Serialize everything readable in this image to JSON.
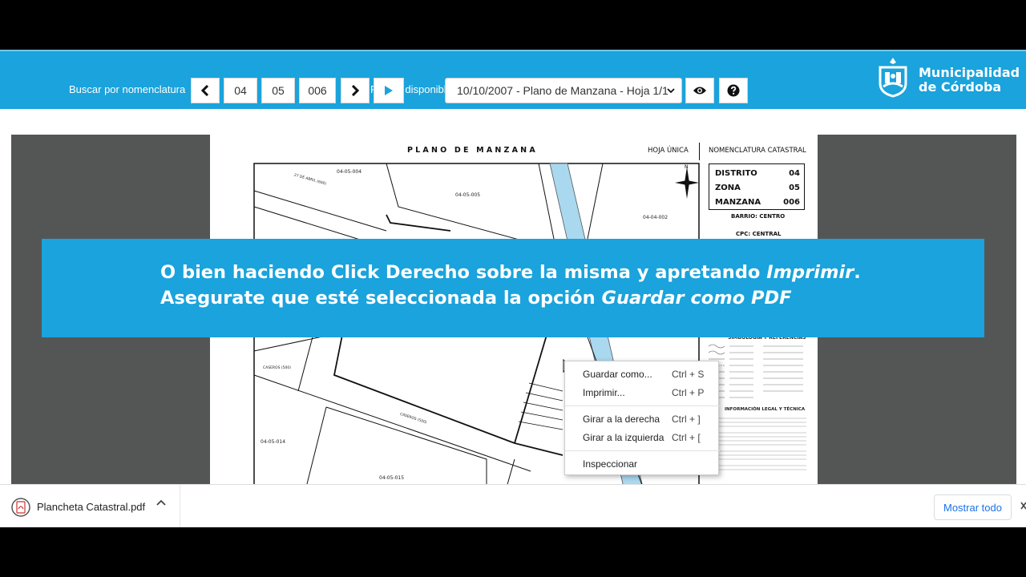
{
  "header": {
    "search_label": "Buscar por nomenclatura",
    "available_label": "Planos disponibles",
    "distrito": "04",
    "zona": "05",
    "manzana": "006",
    "selected_plan": "10/10/2007 - Plano de Manzana - Hoja 1/1",
    "logo_line1": "Municipalidad",
    "logo_line2": "de Córdoba",
    "colors": {
      "brand": "#1aa3dc"
    }
  },
  "sheet": {
    "title": "PLANO DE MANZANA",
    "hoja": "HOJA ÚNICA",
    "nomenclatura_title": "NOMENCLATURA CATASTRAL",
    "rows": [
      {
        "label": "DISTRITO",
        "value": "04"
      },
      {
        "label": "ZONA",
        "value": "05"
      },
      {
        "label": "MANZANA",
        "value": "006"
      }
    ],
    "barrio": "BARRIO: CENTRO",
    "cpc": "CPC: CENTRAL",
    "legend_title": "SIMBOLOGÍA Y REFERENCIAS",
    "info_title": "INFORMACIÓN LEGAL Y TÉCNICA",
    "parcel_labels": [
      "04-05-004",
      "04-05-005",
      "04-04-002",
      "04-05-014",
      "04-05-015"
    ],
    "street_labels": [
      "27 DE ABRIL (600)",
      "CASEROS (500)",
      "CASEROS (500)"
    ]
  },
  "banner": {
    "line1_pre": "O bien haciendo Click Derecho sobre la misma y apretando ",
    "line1_em": "Imprimir",
    "line1_post": ".",
    "line2_pre": "Asegurate que esté seleccionada la opción ",
    "line2_em": "Guardar como PDF"
  },
  "context_menu": {
    "items": [
      {
        "label": "Guardar como...",
        "shortcut": "Ctrl + S"
      },
      {
        "label": "Imprimir...",
        "shortcut": "Ctrl + P"
      },
      {
        "label": "Girar a la derecha",
        "shortcut": "Ctrl + ]"
      },
      {
        "label": "Girar a la izquierda",
        "shortcut": "Ctrl + ["
      },
      {
        "label": "Inspeccionar",
        "shortcut": ""
      }
    ]
  },
  "downloads": {
    "file_name": "Plancheta Catastral.pdf",
    "show_all": "Mostrar todo"
  },
  "icons": [
    "prev-icon",
    "next-icon",
    "play-icon",
    "eye-icon",
    "help-icon",
    "pdf-file-icon",
    "chevron-up-icon",
    "close-icon",
    "compass-icon",
    "city-logo-icon",
    "cursor-icon"
  ]
}
